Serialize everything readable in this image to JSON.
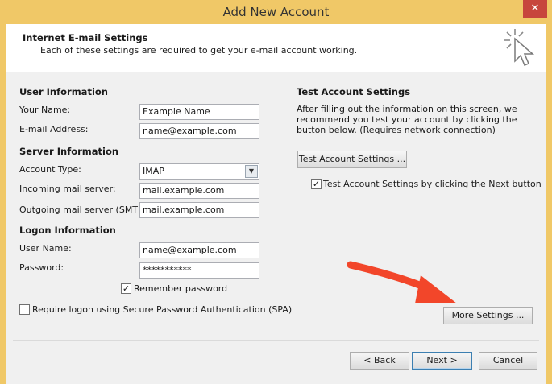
{
  "window": {
    "title": "Add New Account",
    "close_glyph": "✕"
  },
  "header": {
    "title": "Internet E-mail Settings",
    "subtitle": "Each of these settings are required to get your e-mail account working."
  },
  "user_info": {
    "heading": "User Information",
    "name_label": "Your Name:",
    "name_value": "Example Name",
    "email_label": "E-mail Address:",
    "email_value": "name@example.com"
  },
  "server_info": {
    "heading": "Server Information",
    "account_type_label": "Account Type:",
    "account_type_value": "IMAP",
    "incoming_label": "Incoming mail server:",
    "incoming_value": "mail.example.com",
    "outgoing_label": "Outgoing mail server (SMTP):",
    "outgoing_value": "mail.example.com"
  },
  "logon_info": {
    "heading": "Logon Information",
    "username_label": "User Name:",
    "username_value": "name@example.com",
    "password_label": "Password:",
    "password_value": "***********",
    "remember_label": "Remember password",
    "remember_checked": true,
    "spa_label": "Require logon using Secure Password Authentication (SPA)",
    "spa_checked": false
  },
  "test_settings": {
    "heading": "Test Account Settings",
    "description": "After filling out the information on this screen, we recommend you test your account by clicking the button below. (Requires network connection)",
    "test_button": "Test Account Settings ...",
    "next_test_label": "Test Account Settings by clicking the Next button",
    "next_test_checked": true
  },
  "more_settings_button": "More Settings ...",
  "footer": {
    "back": "< Back",
    "next": "Next >",
    "cancel": "Cancel"
  },
  "colors": {
    "titlebar": "#f0c867",
    "close": "#c7463d",
    "arrow": "#f2462a"
  },
  "icons": {
    "window_cursor": "cursor-sparkle-icon",
    "annotation": "red-arrow-icon"
  }
}
